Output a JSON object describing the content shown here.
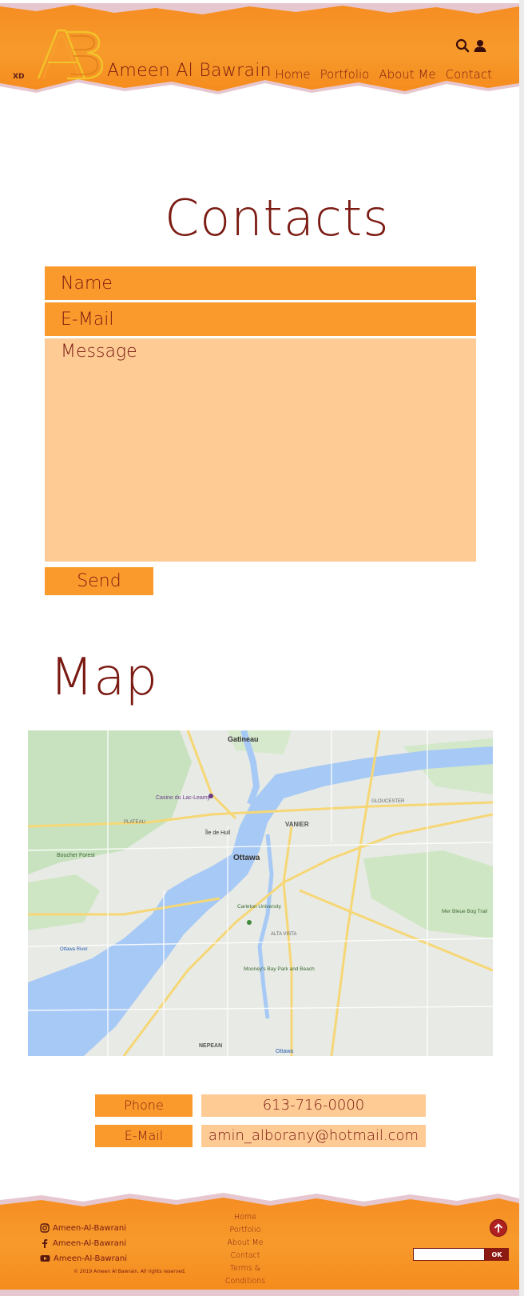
{
  "header": {
    "xd_label": "XD",
    "logo_icon": "ab-monogram-logo",
    "site_title": "Ameen Al Bawrain",
    "nav": [
      "Home",
      "Portfolio",
      "About Me",
      "Contact"
    ],
    "icons": [
      "search-icon",
      "user-icon"
    ]
  },
  "contact": {
    "title": "Contacts",
    "name_placeholder": "Name",
    "email_placeholder": "E-Mail",
    "message_placeholder": "Message",
    "send_label": "Send"
  },
  "map_section": {
    "title": "Map",
    "labels": {
      "gatineau": "Gatineau",
      "casino": "Casino du Lac-Leamy",
      "plateau": "PLATEAU",
      "ile_de_hull": "Île de Hull",
      "vanier": "VANIER",
      "ottawa": "Ottawa",
      "boucher": "Boucher Forest",
      "carleton": "Carleton University",
      "alta_vista": "ALTA VISTA",
      "mooneys": "Mooney's Bay Park and Beach",
      "mer_bleue": "Mer Bleue Bog Trail",
      "nepean": "NEPEAN",
      "ottawa_s": "Ottawa",
      "gloucester": "GLOUCESTER",
      "britannia": "Ottawa River"
    }
  },
  "info": {
    "phone_label": "Phone",
    "phone_value": "613-716-0000",
    "email_label": "E-Mail",
    "email_value": "amin_alborany@hotmail.com"
  },
  "footer": {
    "social": [
      {
        "icon": "instagram-icon",
        "label": "Ameen-Al-Bawrani"
      },
      {
        "icon": "facebook-icon",
        "label": "Ameen-Al-Bawrani"
      },
      {
        "icon": "youtube-icon",
        "label": "Ameen-Al-Bawrani"
      }
    ],
    "copyright": "© 2019 Ameen Al Bawrain. All rights reserved.",
    "links": [
      "Home",
      "Portfolio",
      "About Me",
      "Contact",
      "Terms & Conditions"
    ],
    "ok_label": "OK"
  },
  "colors": {
    "primary_orange": "#fb9a2c",
    "light_orange": "#fecb95",
    "text_maroon": "#7a1a12"
  }
}
